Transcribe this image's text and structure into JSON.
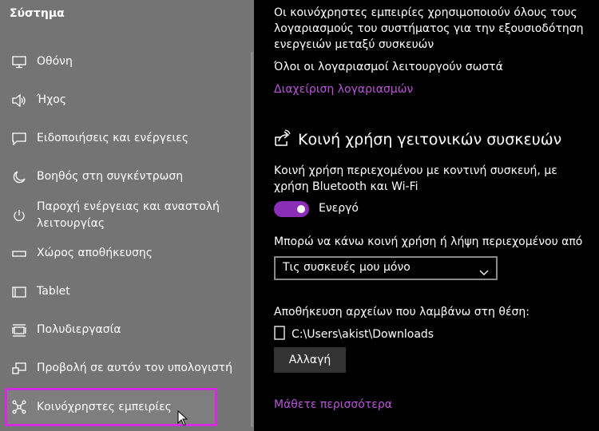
{
  "sidebar": {
    "title": "Σύστημα",
    "items": [
      {
        "label": "Οθόνη",
        "icon": "monitor-icon"
      },
      {
        "label": "Ήχος",
        "icon": "speaker-icon"
      },
      {
        "label": "Ειδοποιήσεις και ενέργειες",
        "icon": "notification-icon"
      },
      {
        "label": "Βοηθός στη συγκέντρωση",
        "icon": "moon-icon"
      },
      {
        "label": "Παροχή ενέργειας και αναστολή λειτουργίας",
        "icon": "power-icon"
      },
      {
        "label": "Χώρος αποθήκευσης",
        "icon": "storage-icon"
      },
      {
        "label": "Tablet",
        "icon": "tablet-icon"
      },
      {
        "label": "Πολυδιεργασία",
        "icon": "multitasking-icon"
      },
      {
        "label": "Προβολή σε αυτόν τον υπολογιστή",
        "icon": "projecting-icon"
      },
      {
        "label": "Κοινόχρηστες εμπειρίες",
        "icon": "shared-experiences-icon",
        "selected": true
      }
    ]
  },
  "content": {
    "intro_text": "Οι κοινόχρηστες εμπειρίες χρησιμοποιούν όλους τους λογαριασμούς του συστήματος για την εξουσιοδότηση ενεργειών μεταξύ συσκευών",
    "accounts_status": "Όλοι οι λογαριασμοί λειτουργούν σωστά",
    "manage_accounts_link": "Διαχείριση λογαριασμών",
    "section_title": "Κοινή χρήση γειτονικών συσκευών",
    "section_description": "Κοινή χρήση περιεχομένου με κοντινή συσκευή, με χρήση Bluetooth και Wi-Fi",
    "toggle_state": "Ενεργό",
    "share_receive_label": "Μπορώ να κάνω κοινή χρήση ή λήψη περιεχομένου από",
    "dropdown_value": "Τις συσκευές μου μόνο",
    "save_location_label": "Αποθήκευση αρχείων που λαμβάνω στη θέση:",
    "save_path": "C:\\Users\\akist\\Downloads",
    "change_button": "Αλλαγή",
    "learn_more_link": "Μάθετε περισσότερα"
  },
  "colors": {
    "accent": "#b856d6",
    "toggle_on": "#8a2eb8",
    "selection_border": "#d22ee0",
    "sidebar_bg": "#747474"
  }
}
